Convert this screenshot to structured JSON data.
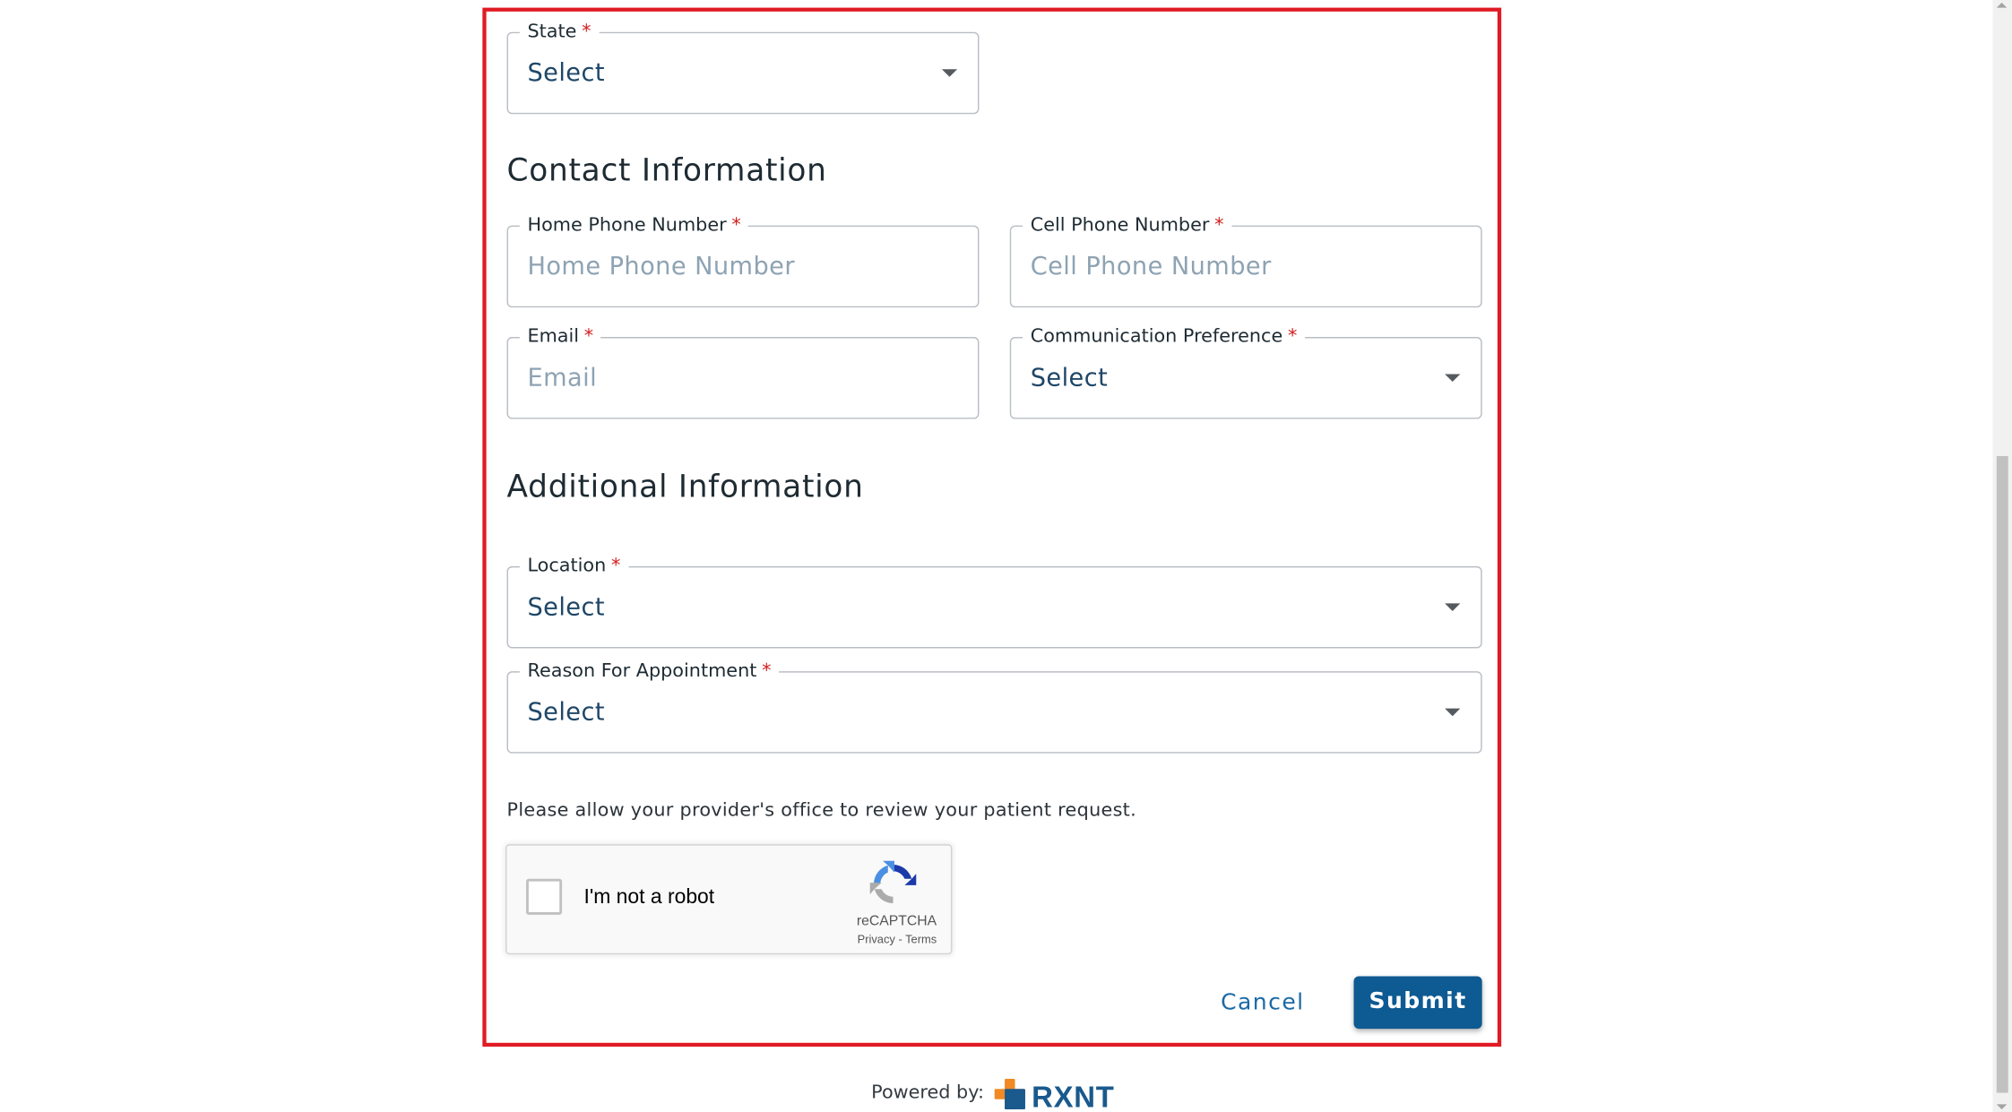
{
  "address": {
    "state": {
      "label": "State",
      "value": "Select"
    }
  },
  "contact": {
    "title": "Contact Information",
    "home_phone": {
      "label": "Home Phone Number",
      "placeholder": "Home Phone Number"
    },
    "cell_phone": {
      "label": "Cell Phone Number",
      "placeholder": "Cell Phone Number"
    },
    "email": {
      "label": "Email",
      "placeholder": "Email"
    },
    "communication_preference": {
      "label": "Communication Preference",
      "value": "Select"
    }
  },
  "additional": {
    "title": "Additional Information",
    "location": {
      "label": "Location",
      "value": "Select"
    },
    "reason": {
      "label": "Reason For Appointment",
      "value": "Select"
    }
  },
  "required_marker": "*",
  "notice": "Please allow your provider's office to review your patient request.",
  "captcha": {
    "label": "I'm not a robot",
    "brand": "reCAPTCHA",
    "privacy": "Privacy",
    "separator": " - ",
    "terms": "Terms",
    "icon": "recaptcha-icon"
  },
  "actions": {
    "cancel": "Cancel",
    "submit": "Submit"
  },
  "footer": {
    "powered_by": "Powered by:",
    "brand": "RXNT",
    "logo_icon": "rxnt-cross-icon"
  },
  "colors": {
    "highlight_border": "#e01b24",
    "primary": "#0e5a92",
    "link": "#1b6aa6",
    "required": "#d21f1f"
  }
}
